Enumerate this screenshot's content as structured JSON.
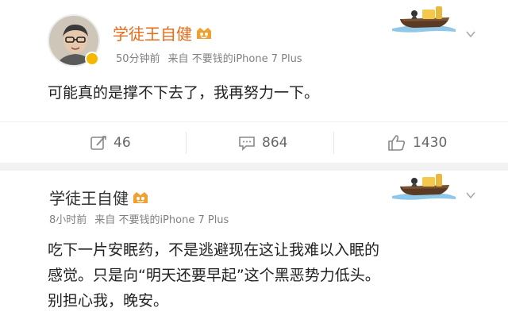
{
  "posts": [
    {
      "author": "学徒王自健",
      "time": "50分钟前",
      "source_prefix": "来自",
      "source_device": "不要钱的iPhone 7 Plus",
      "content": [
        "可能真的是撑不下去了，我再努力一下。"
      ],
      "actions": {
        "repost_count": "46",
        "comment_count": "864",
        "like_count": "1430"
      }
    },
    {
      "author": "学徒王自健",
      "time": "8小时前",
      "source_prefix": "来自",
      "source_device": "不要钱的iPhone 7 Plus",
      "content": [
        "吃下一片安眠药，不是逃避现在这让我难以入眠的",
        "感觉。只是向“明天还要早起”这个黑恶势力低头。",
        "别担心我，晚安。"
      ]
    }
  ],
  "colors": {
    "author_orange": "#e86a16",
    "meta_gray": "#808080",
    "divider": "#f2f2f2"
  },
  "icons": [
    "avatar",
    "verified-badge",
    "member-badge-icon",
    "boat-icon",
    "chevron-down-icon",
    "repost-icon",
    "comment-icon",
    "like-icon"
  ]
}
